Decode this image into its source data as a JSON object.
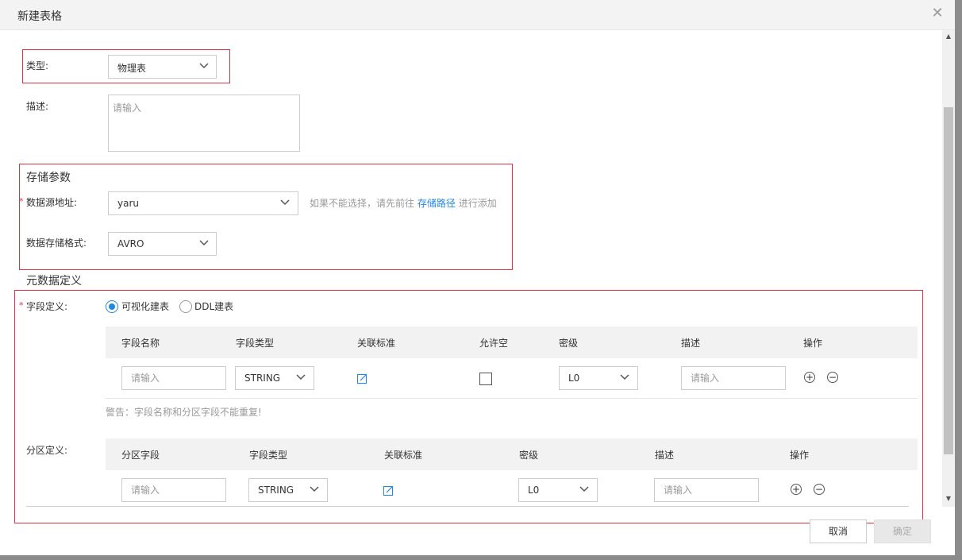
{
  "dialog": {
    "title": "新建表格"
  },
  "form": {
    "type_label": "类型:",
    "type_value": "物理表",
    "desc_label": "描述:",
    "desc_placeholder": "请输入",
    "storage_title": "存储参数",
    "datasource_label": "数据源地址:",
    "datasource_value": "yaru",
    "hint_prefix": "如果不能选择，请先前往",
    "hint_link": "存储路径",
    "hint_suffix": "进行添加",
    "format_label": "数据存储格式:",
    "format_value": "AVRO",
    "meta_title": "元数据定义",
    "field_label": "字段定义:",
    "radio_visual": "可视化建表",
    "radio_ddl": "DDL建表",
    "partition_label": "分区定义:",
    "required_mark": "*"
  },
  "fields_table": {
    "headers": [
      "字段名称",
      "字段类型",
      "关联标准",
      "允许空",
      "密级",
      "描述",
      "操作"
    ],
    "row": {
      "name_placeholder": "请输入",
      "type_value": "STRING",
      "level_value": "L0",
      "desc_placeholder": "请输入"
    },
    "warning": "警告：字段名称和分区字段不能重复!"
  },
  "partition_table": {
    "headers": [
      "分区字段",
      "字段类型",
      "关联标准",
      "密级",
      "描述",
      "操作"
    ],
    "row": {
      "name_placeholder": "请输入",
      "type_value": "STRING",
      "level_value": "L0",
      "desc_placeholder": "请输入"
    }
  },
  "footer": {
    "cancel": "取消",
    "ok": "确定"
  },
  "icons": {
    "close": "close-icon",
    "dropdown": "chevron-down-icon",
    "edit": "edit-icon",
    "add": "plus-circle-icon",
    "remove": "minus-circle-icon"
  },
  "colors": {
    "accent": "#1e88e5",
    "highlight_box": "#e0323f",
    "required": "#e0323f"
  }
}
